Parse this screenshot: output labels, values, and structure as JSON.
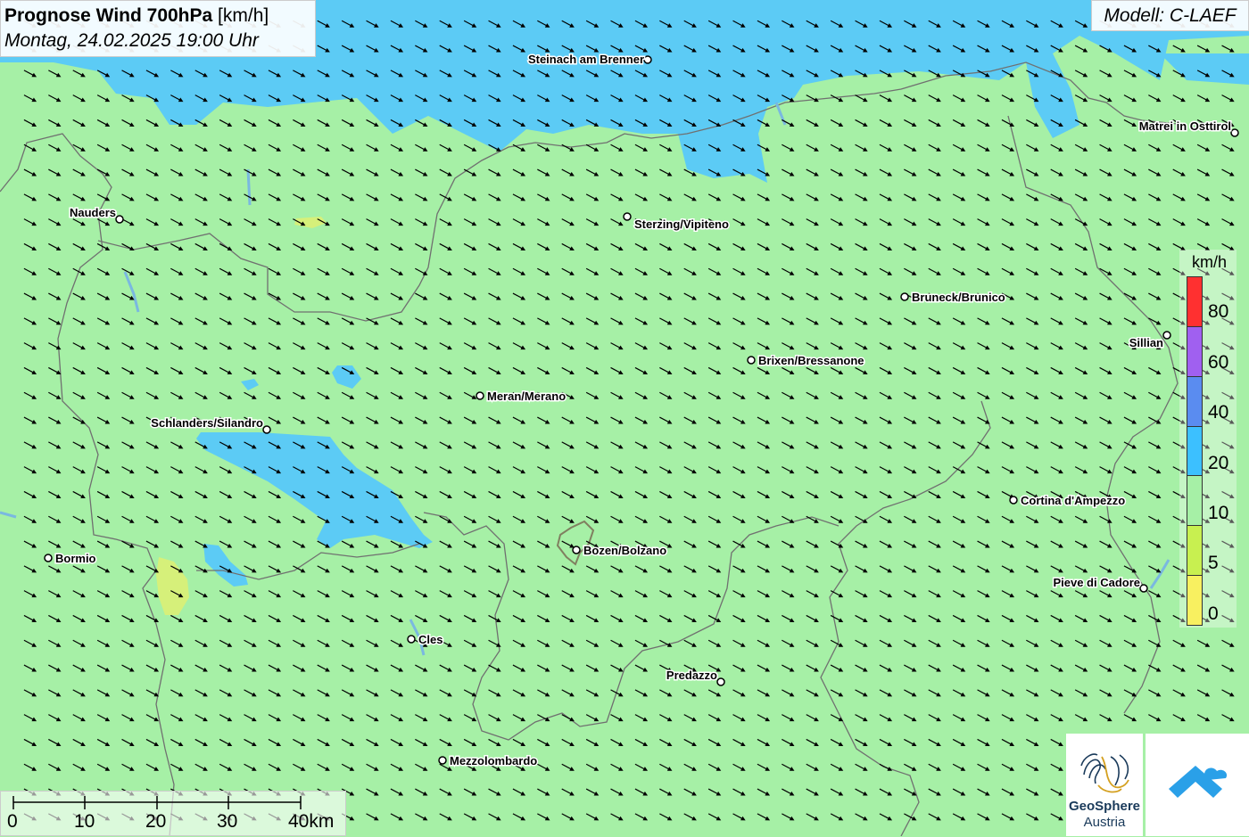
{
  "title": {
    "main": "Prognose Wind 700hPa",
    "unit": "[km/h]",
    "datetime": "Montag, 24.02.2025 19:00 Uhr"
  },
  "model": "Modell: C-LAEF",
  "legend": {
    "unit": "km/h",
    "labels": [
      "80",
      "60",
      "40",
      "20",
      "10",
      "5",
      "0"
    ],
    "colors": [
      "#ff3030",
      "#a060f0",
      "#5a8cf0",
      "#3cc0ff",
      "#a6f0a6",
      "#c8f050",
      "#f8f060"
    ]
  },
  "scale": {
    "labels": [
      "0",
      "10",
      "20",
      "30",
      "40km"
    ]
  },
  "cities": [
    {
      "name": "Steinach am Brenner"
    },
    {
      "name": "Matrei in Osttirol"
    },
    {
      "name": "Nauders"
    },
    {
      "name": "Sterzing/Vipiteno"
    },
    {
      "name": "Bruneck/Brunico"
    },
    {
      "name": "Sillian"
    },
    {
      "name": "Brixen/Bressanone"
    },
    {
      "name": "Meran/Merano"
    },
    {
      "name": "Schlanders/Silandro"
    },
    {
      "name": "Cortina d'Ampezzo"
    },
    {
      "name": "Bozen/Bolzano"
    },
    {
      "name": "Bormio"
    },
    {
      "name": "Pieve di Cadore"
    },
    {
      "name": "Cles"
    },
    {
      "name": "Predazzo"
    },
    {
      "name": "Mezzolombardo"
    }
  ],
  "logos": {
    "geosphere_line1": "GeoSphere",
    "geosphere_line2": "Austria"
  },
  "colors": {
    "base_field": "#a6f0a6",
    "wind_20_40": "#5ccbf5",
    "wind_5_10": "#d6f07a",
    "arrow": "#000000",
    "border": "#707070"
  }
}
